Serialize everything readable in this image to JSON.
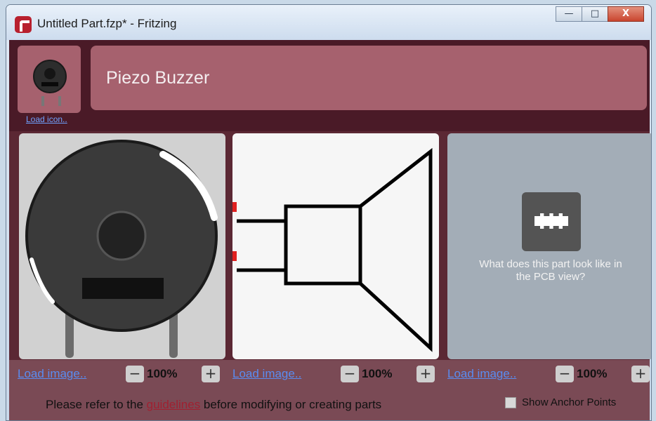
{
  "window": {
    "title": "Untitled Part.fzp* - Fritzing",
    "controls": {
      "minimize": "—",
      "maximize": "□",
      "close": "X"
    }
  },
  "part": {
    "title": "Piezo Buzzer",
    "load_icon_label": "Load icon.."
  },
  "views": [
    {
      "name": "breadboard",
      "load_label": "Load image..",
      "zoom": "100%"
    },
    {
      "name": "schematic",
      "load_label": "Load image..",
      "zoom": "100%"
    },
    {
      "name": "pcb",
      "load_label": "Load image..",
      "zoom": "100%",
      "placeholder_text": "What does this part look like in the PCB view?"
    }
  ],
  "zoom_controls": {
    "minus": "−",
    "plus": "+"
  },
  "footer": {
    "prefix": "Please refer to the ",
    "link": "guidelines",
    "suffix": " before modifying or creating parts",
    "show_anchor_points": "Show Anchor Points"
  },
  "colors": {
    "header_bg": "#4a1a27",
    "header_box": "#a6616e",
    "link": "#5a8cf0",
    "guidelines_link": "#a02030"
  }
}
